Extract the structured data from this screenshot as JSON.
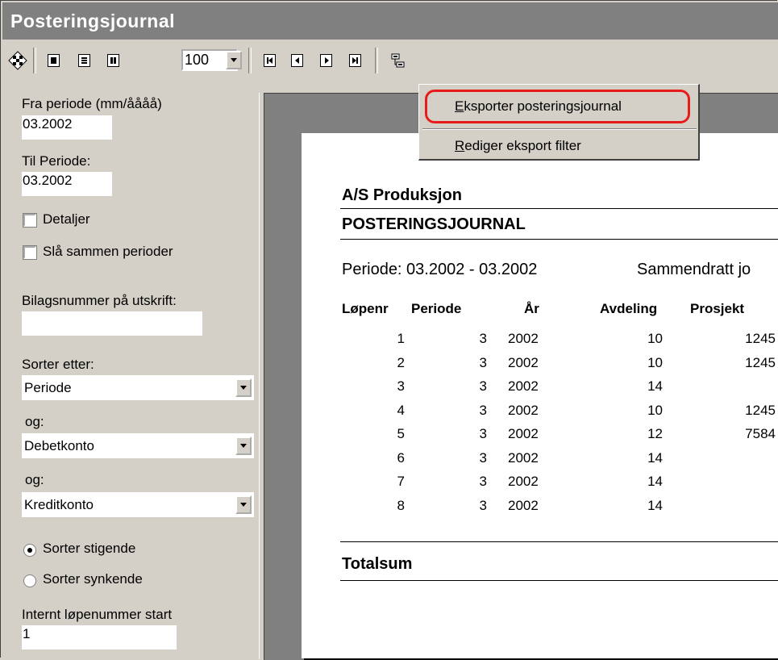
{
  "window": {
    "title": "Posteringsjournal"
  },
  "toolbar": {
    "zoom_value": "100"
  },
  "filters": {
    "fra_label": "Fra periode (mm/åååå)",
    "fra_value": "03.2002",
    "til_label": "Til Periode:",
    "til_value": "03.2002",
    "detaljer_label": "Detaljer",
    "sla_sammen_label": "Slå sammen perioder",
    "bilagsnummer_label": "Bilagsnummer på utskrift:",
    "bilagsnummer_value": "",
    "sorter_label": "Sorter etter:",
    "sort1_value": "Periode",
    "og1_label": "og:",
    "sort2_value": "Debetkonto",
    "og2_label": "og:",
    "sort3_value": "Kreditkonto",
    "stigende_label": "Sorter stigende",
    "synkende_label": "Sorter synkende",
    "lopenr_label": "Internt løpenummer start",
    "lopenr_value": "1"
  },
  "menu": {
    "export_first": "E",
    "export_rest": "ksporter posteringsjournal",
    "edit_first": "R",
    "edit_rest": "ediger eksport filter"
  },
  "report": {
    "company": "A/S Produksjon",
    "title": "POSTERINGSJOURNAL",
    "periode": "Periode: 03.2002 - 03.2002",
    "sammendratt": "Sammendratt jo",
    "columns": [
      "Løpenr",
      "Periode",
      "År",
      "Avdeling",
      "Prosjekt"
    ],
    "rows": [
      [
        "1",
        "3",
        "2002",
        "10",
        "1245"
      ],
      [
        "2",
        "3",
        "2002",
        "10",
        "1245"
      ],
      [
        "3",
        "3",
        "2002",
        "14",
        ""
      ],
      [
        "4",
        "3",
        "2002",
        "10",
        "1245"
      ],
      [
        "5",
        "3",
        "2002",
        "12",
        "7584"
      ],
      [
        "6",
        "3",
        "2002",
        "14",
        ""
      ],
      [
        "7",
        "3",
        "2002",
        "14",
        ""
      ],
      [
        "8",
        "3",
        "2002",
        "14",
        ""
      ]
    ],
    "total_label": "Totalsum"
  }
}
